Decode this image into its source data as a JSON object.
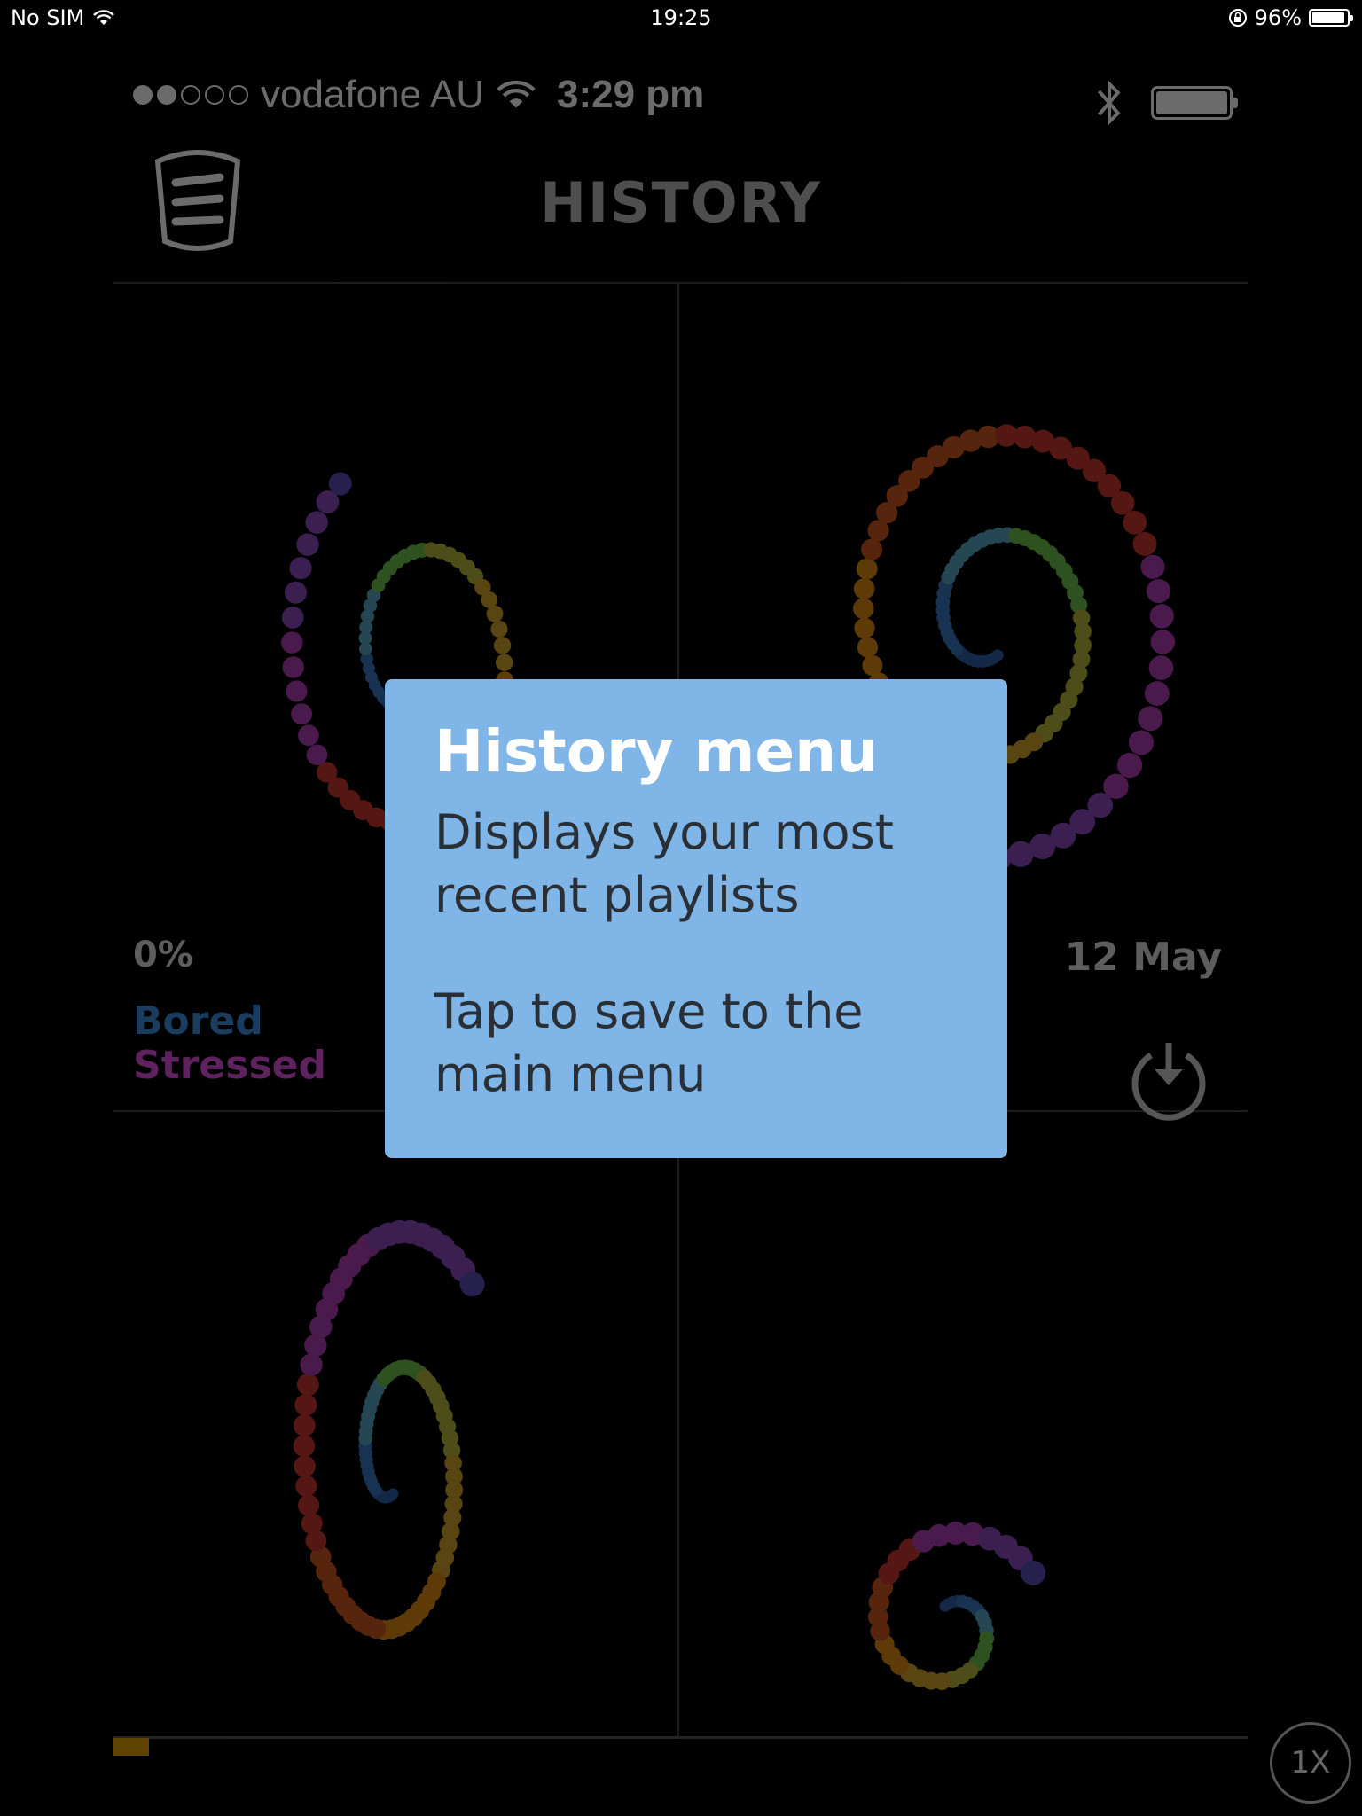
{
  "system_status": {
    "carrier": "No SIM",
    "time": "19:25",
    "battery": "96%"
  },
  "app_status": {
    "carrier": "vodafone AU",
    "time": "3:29 pm"
  },
  "header": {
    "title": "HISTORY"
  },
  "tile_top_left": {
    "percent": "0%",
    "moods": [
      "Bored",
      "Stressed"
    ]
  },
  "tile_top_right": {
    "date": "12 May"
  },
  "speed_button": {
    "label": "1X"
  },
  "tooltip": {
    "title": "History menu",
    "line1": "Displays your most recent playlists",
    "line2": "Tap to save to the main menu"
  },
  "colors": {
    "accent_tooltip": "#7fb5e7",
    "mood_bored": "#3f8fe0",
    "mood_stressed": "#e055e0",
    "progress": "#e8a000"
  }
}
